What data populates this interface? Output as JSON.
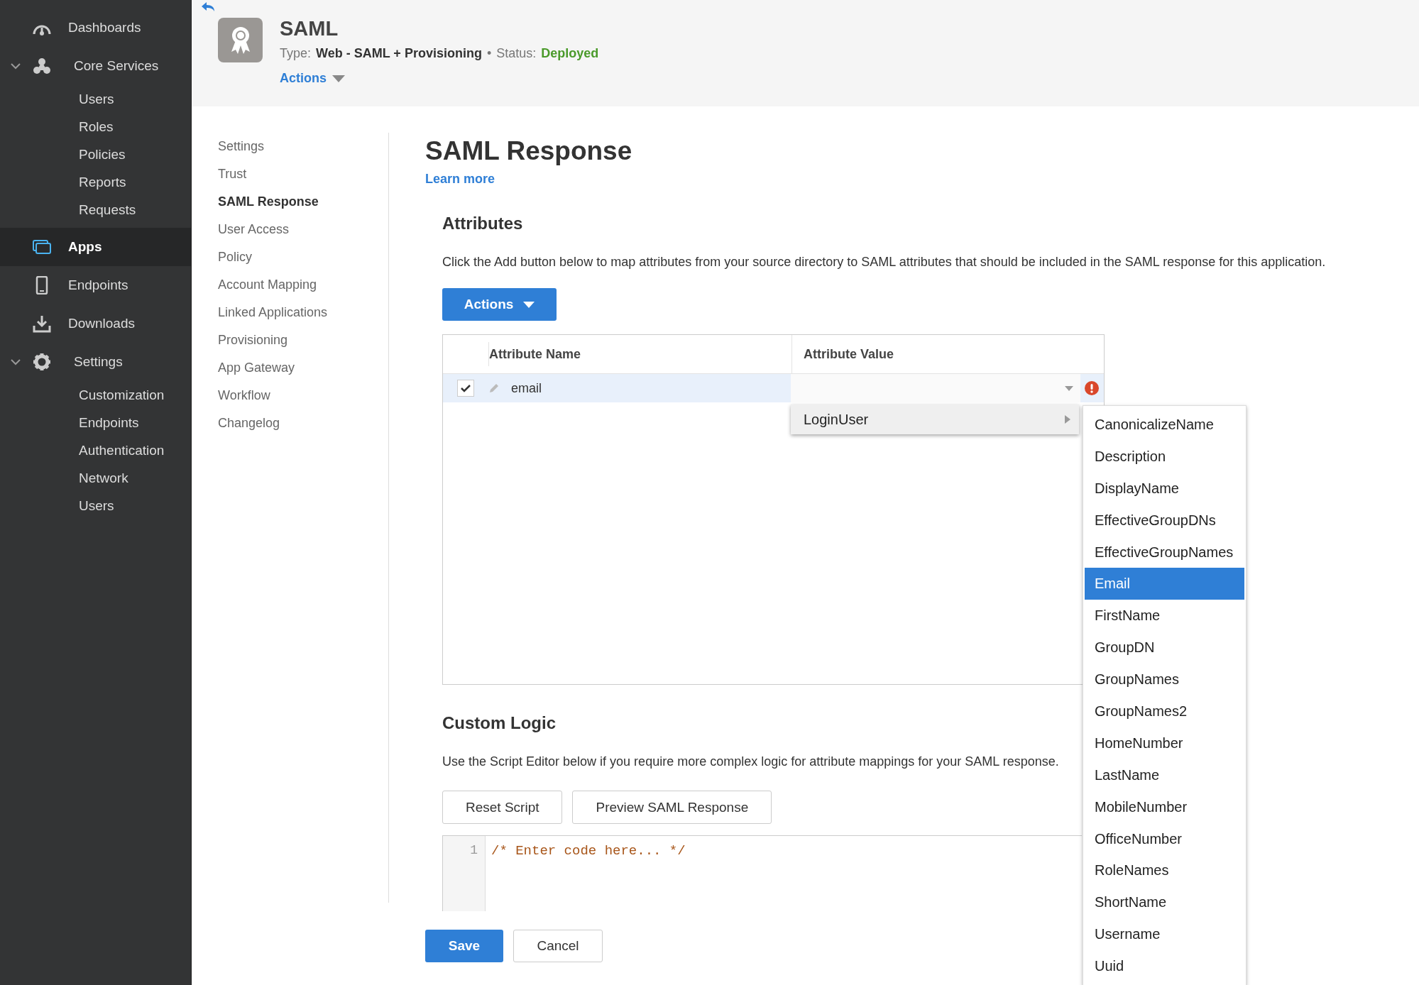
{
  "sidebar": {
    "items": [
      {
        "label": "Dashboards",
        "kind": "dashboard",
        "selected": false
      },
      {
        "label": "Core Services",
        "kind": "services",
        "selected": false,
        "expanded": true,
        "children": [
          {
            "label": "Users"
          },
          {
            "label": "Roles"
          },
          {
            "label": "Policies"
          },
          {
            "label": "Reports"
          },
          {
            "label": "Requests"
          }
        ]
      },
      {
        "label": "Apps",
        "kind": "apps",
        "selected": true
      },
      {
        "label": "Endpoints",
        "kind": "device",
        "selected": false
      },
      {
        "label": "Downloads",
        "kind": "download",
        "selected": false
      },
      {
        "label": "Settings",
        "kind": "gear",
        "selected": false,
        "expanded": true,
        "children": [
          {
            "label": "Customization"
          },
          {
            "label": "Endpoints"
          },
          {
            "label": "Authentication"
          },
          {
            "label": "Network"
          },
          {
            "label": "Users"
          }
        ]
      }
    ]
  },
  "header": {
    "title": "SAML",
    "type_label": "Type:",
    "type_value": "Web - SAML + Provisioning",
    "separator": "•",
    "status_label": "Status:",
    "status_value": "Deployed",
    "actions": "Actions"
  },
  "subnav": [
    {
      "label": "Settings",
      "selected": false
    },
    {
      "label": "Trust",
      "selected": false
    },
    {
      "label": "SAML Response",
      "selected": true
    },
    {
      "label": "User Access",
      "selected": false
    },
    {
      "label": "Policy",
      "selected": false
    },
    {
      "label": "Account Mapping",
      "selected": false
    },
    {
      "label": "Linked Applications",
      "selected": false
    },
    {
      "label": "Provisioning",
      "selected": false
    },
    {
      "label": "App Gateway",
      "selected": false
    },
    {
      "label": "Workflow",
      "selected": false
    },
    {
      "label": "Changelog",
      "selected": false
    }
  ],
  "page": {
    "title": "SAML Response",
    "learn_more": "Learn more"
  },
  "attributes": {
    "heading": "Attributes",
    "description": "Click the Add button below to map attributes from your source directory to SAML attributes that should be included in the SAML response for this application.",
    "actions": "Actions",
    "table": {
      "columns": [
        "Attribute Name",
        "Attribute Value"
      ],
      "rows": [
        {
          "name": "email",
          "checked": true,
          "selected": true,
          "error": true
        }
      ]
    },
    "menu": {
      "items": [
        {
          "label": "LoginUser",
          "has_submenu": true
        }
      ]
    },
    "submenu": {
      "items": [
        {
          "label": "CanonicalizeName",
          "selected": false
        },
        {
          "label": "Description",
          "selected": false
        },
        {
          "label": "DisplayName",
          "selected": false
        },
        {
          "label": "EffectiveGroupDNs",
          "selected": false
        },
        {
          "label": "EffectiveGroupNames",
          "selected": false
        },
        {
          "label": "Email",
          "selected": true
        },
        {
          "label": "FirstName",
          "selected": false
        },
        {
          "label": "GroupDN",
          "selected": false
        },
        {
          "label": "GroupNames",
          "selected": false
        },
        {
          "label": "GroupNames2",
          "selected": false
        },
        {
          "label": "HomeNumber",
          "selected": false
        },
        {
          "label": "LastName",
          "selected": false
        },
        {
          "label": "MobileNumber",
          "selected": false
        },
        {
          "label": "OfficeNumber",
          "selected": false
        },
        {
          "label": "RoleNames",
          "selected": false
        },
        {
          "label": "ShortName",
          "selected": false
        },
        {
          "label": "Username",
          "selected": false
        },
        {
          "label": "Uuid",
          "selected": false
        }
      ]
    }
  },
  "custom_logic": {
    "heading": "Custom Logic",
    "description": "Use the Script Editor below if you require more complex logic for attribute mappings for your SAML response.",
    "buttons": [
      "Reset Script",
      "Preview SAML Response"
    ],
    "editor": {
      "lines": [
        {
          "number": "1",
          "code": "/* Enter code here... */"
        }
      ]
    }
  },
  "footer_buttons": [
    {
      "label": "Save",
      "kind": "primary"
    },
    {
      "label": "Cancel",
      "kind": "secondary"
    }
  ]
}
